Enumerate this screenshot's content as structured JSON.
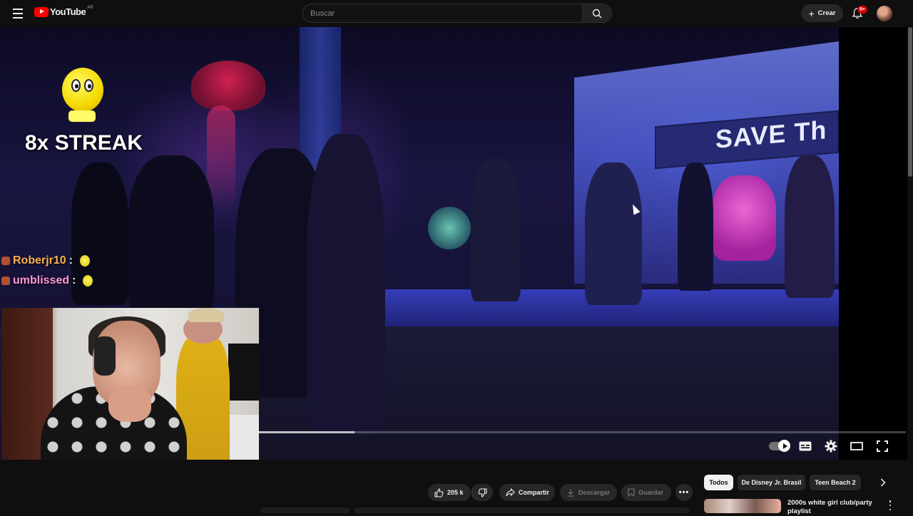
{
  "header": {
    "logo_text": "YouTube",
    "region": "AR",
    "search_placeholder": "Buscar",
    "create_label": "Crear",
    "notifications_badge": "9+"
  },
  "overlay": {
    "streak_text": "8x STREAK",
    "chat": [
      {
        "user": "Roberjr10",
        "sep": ":"
      },
      {
        "user": "umblissed",
        "sep": ":"
      }
    ]
  },
  "video": {
    "banner_text": "SAVE Th",
    "progress_fraction": 0.148
  },
  "actions": {
    "likes": "205 k",
    "share": "Compartir",
    "download": "Descargar",
    "save": "Guardar"
  },
  "chips": [
    "Todos",
    "De Disney Jr. Brasil",
    "Teen Beach 2"
  ],
  "recommendation": {
    "title": "2000s white girl club/party playlist"
  },
  "colors": {
    "brand_red": "#ff0000",
    "badge_red": "#cc0000",
    "chat_name_1": "#ffb04c",
    "chat_name_2": "#ff9ad6"
  }
}
